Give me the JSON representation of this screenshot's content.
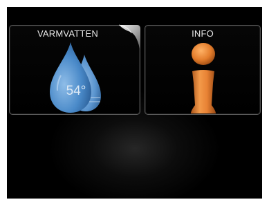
{
  "tiles": {
    "varmvatten": {
      "label": "VARMVATTEN",
      "value": "54°",
      "icon": "water-drop-icon"
    },
    "info": {
      "label": "INFO",
      "icon": "info-icon"
    }
  },
  "colors": {
    "drop_blue": "#4a8ac9",
    "info_orange": "#e07a2a",
    "tile_border": "#5a5a5a",
    "background": "#000000"
  }
}
